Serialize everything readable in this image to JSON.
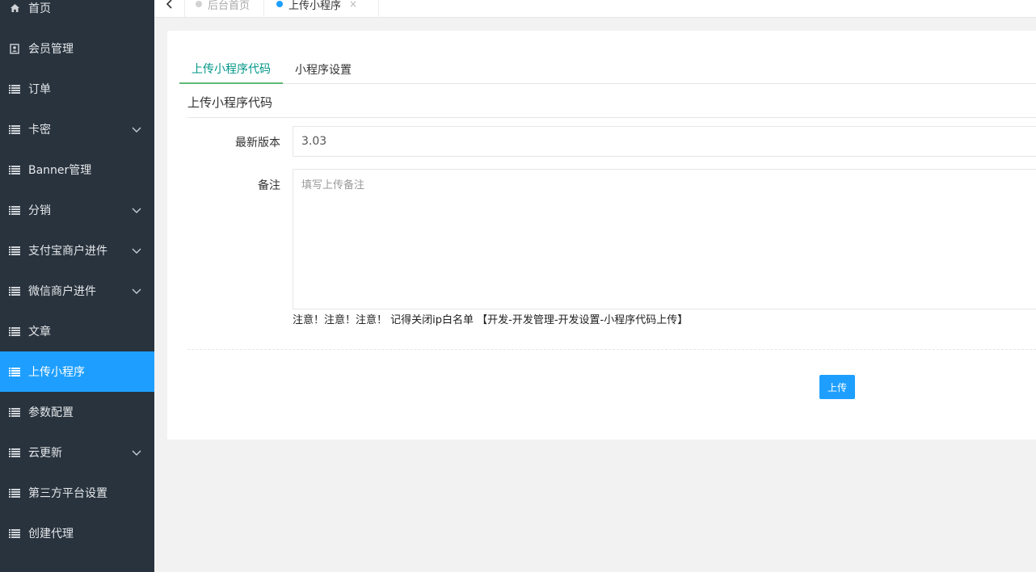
{
  "sidebar": {
    "items": [
      {
        "label": "首页",
        "icon": "home-icon",
        "chevron": false,
        "active": false
      },
      {
        "label": "会员管理",
        "icon": "member-card-icon",
        "chevron": false,
        "active": false
      },
      {
        "label": "订单",
        "icon": "list-icon",
        "chevron": false,
        "active": false
      },
      {
        "label": "卡密",
        "icon": "list-icon",
        "chevron": true,
        "active": false
      },
      {
        "label": "Banner管理",
        "icon": "list-icon",
        "chevron": false,
        "active": false
      },
      {
        "label": "分销",
        "icon": "list-icon",
        "chevron": true,
        "active": false
      },
      {
        "label": "支付宝商户进件",
        "icon": "list-icon",
        "chevron": true,
        "active": false
      },
      {
        "label": "微信商户进件",
        "icon": "list-icon",
        "chevron": true,
        "active": false
      },
      {
        "label": "文章",
        "icon": "list-icon",
        "chevron": false,
        "active": false
      },
      {
        "label": "上传小程序",
        "icon": "list-icon",
        "chevron": false,
        "active": true
      },
      {
        "label": "参数配置",
        "icon": "list-icon",
        "chevron": false,
        "active": false
      },
      {
        "label": "云更新",
        "icon": "list-icon",
        "chevron": true,
        "active": false
      },
      {
        "label": "第三方平台设置",
        "icon": "list-icon",
        "chevron": false,
        "active": false
      },
      {
        "label": "创建代理",
        "icon": "list-icon",
        "chevron": false,
        "active": false
      }
    ]
  },
  "topbar": {
    "tabs": [
      {
        "label": "后台首页",
        "dot_color": "#d2d2d2",
        "closable": false
      },
      {
        "label": "上传小程序",
        "dot_color": "#1e9fff",
        "closable": true,
        "close_symbol": "×"
      }
    ]
  },
  "content": {
    "tabs": [
      {
        "label": "上传小程序代码",
        "active": true
      },
      {
        "label": "小程序设置",
        "active": false
      }
    ],
    "section_title": "上传小程序代码",
    "version_label": "最新版本",
    "version_value": "3.03",
    "remark_label": "备注",
    "remark_placeholder": "填写上传备注",
    "notice": "注意！注意！注意！ 记得关闭ip白名单 【开发-开发管理-开发设置-小程序代码上传】",
    "submit_label": "上传"
  },
  "colors": {
    "sidebar_bg": "#28333e",
    "accent_blue": "#1e9fff",
    "tab_active_text": "#009688",
    "tab_active_underline": "#5fb878"
  }
}
